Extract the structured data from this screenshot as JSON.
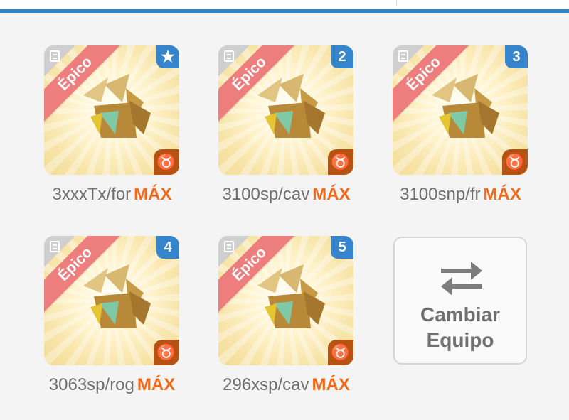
{
  "rarity_label": "Épico",
  "element_symbol": "♉",
  "accent_color": "#f06a19",
  "badge_color": "#3584cc",
  "ribbon_color": "#ee7d7d",
  "cards": [
    {
      "slot": "★",
      "name": "3xxxTx/for",
      "level": "MÁX"
    },
    {
      "slot": "2",
      "name": "3100sp/cav",
      "level": "MÁX"
    },
    {
      "slot": "3",
      "name": "3100snp/fr",
      "level": "MÁX"
    },
    {
      "slot": "4",
      "name": "3063sp/rog",
      "level": "MÁX"
    },
    {
      "slot": "5",
      "name": "296xsp/cav",
      "level": "MÁX"
    }
  ],
  "swap_button": {
    "line1": "Cambiar",
    "line2": "Equipo",
    "icon": "swap-arrows-icon"
  }
}
